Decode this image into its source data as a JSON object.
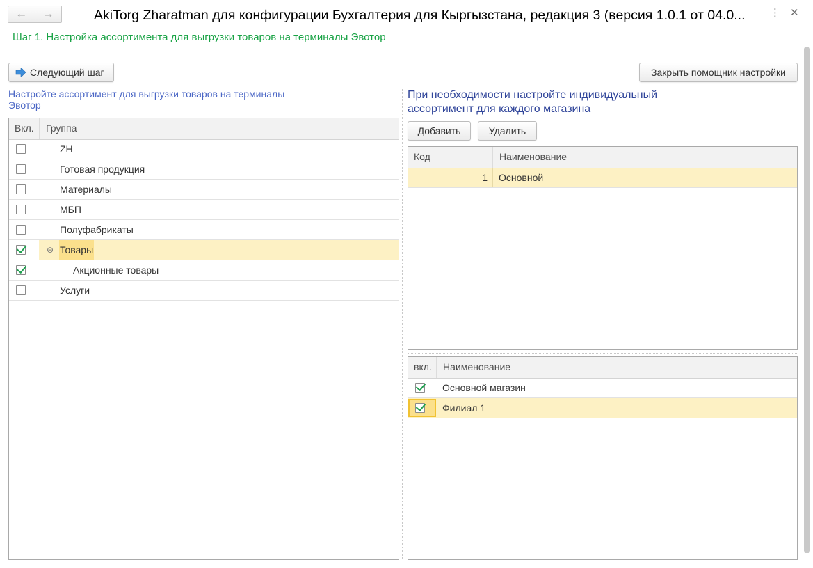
{
  "window": {
    "title": "AkiTorg Zharatman для конфигурации Бухгалтерия для Кыргызстана, редакция 3 (версия 1.0.1 от 04.0...",
    "back_icon": "arrow-left-icon",
    "forward_icon": "arrow-right-icon",
    "more_icon": "more-vertical-icon",
    "close_icon": "close-icon"
  },
  "step_title": "Шаг 1. Настройка ассортимента для выгрузки товаров на терминалы Эвотор",
  "toolbar": {
    "next_label": "Следующий шаг",
    "next_icon": "arrow-right-blue-icon",
    "close_assistant_label": "Закрыть помощник настройки"
  },
  "left": {
    "hint": "Настройте ассортимент для выгрузки товаров на терминалы Эвотор",
    "columns": {
      "enabled": "Вкл.",
      "group": "Группа"
    },
    "rows": [
      {
        "label": "ZH",
        "checked": false,
        "level": 0,
        "selected": false
      },
      {
        "label": "Готовая продукция",
        "checked": false,
        "level": 0,
        "selected": false
      },
      {
        "label": "Материалы",
        "checked": false,
        "level": 0,
        "selected": false
      },
      {
        "label": "МБП",
        "checked": false,
        "level": 0,
        "selected": false
      },
      {
        "label": "Полуфабрикаты",
        "checked": false,
        "level": 0,
        "selected": false
      },
      {
        "label": "Товары",
        "checked": true,
        "level": 0,
        "selected": true,
        "expand": "⊖"
      },
      {
        "label": "Акционные товары",
        "checked": true,
        "level": 1,
        "selected": false
      },
      {
        "label": "Услуги",
        "checked": false,
        "level": 0,
        "selected": false
      }
    ]
  },
  "right": {
    "hint": "При необходимости настройте индивидуальный ассортимент для каждого магазина",
    "add_label": "Добавить",
    "delete_label": "Удалить",
    "assortment_table": {
      "columns": {
        "code": "Код",
        "name": "Наименование"
      },
      "rows": [
        {
          "code": "1",
          "name": "Основной",
          "selected": true
        }
      ]
    },
    "stores_table": {
      "columns": {
        "enabled": "вкл.",
        "name": "Наименование"
      },
      "rows": [
        {
          "name": "Основной магазин",
          "checked": true,
          "selected": false
        },
        {
          "name": "Филиал 1",
          "checked": true,
          "selected": true
        }
      ]
    }
  },
  "colors": {
    "accent_green": "#1aa346",
    "hint_blue": "#4a66c5",
    "selection": "#fdf1c4",
    "checkmark": "#20a050"
  }
}
